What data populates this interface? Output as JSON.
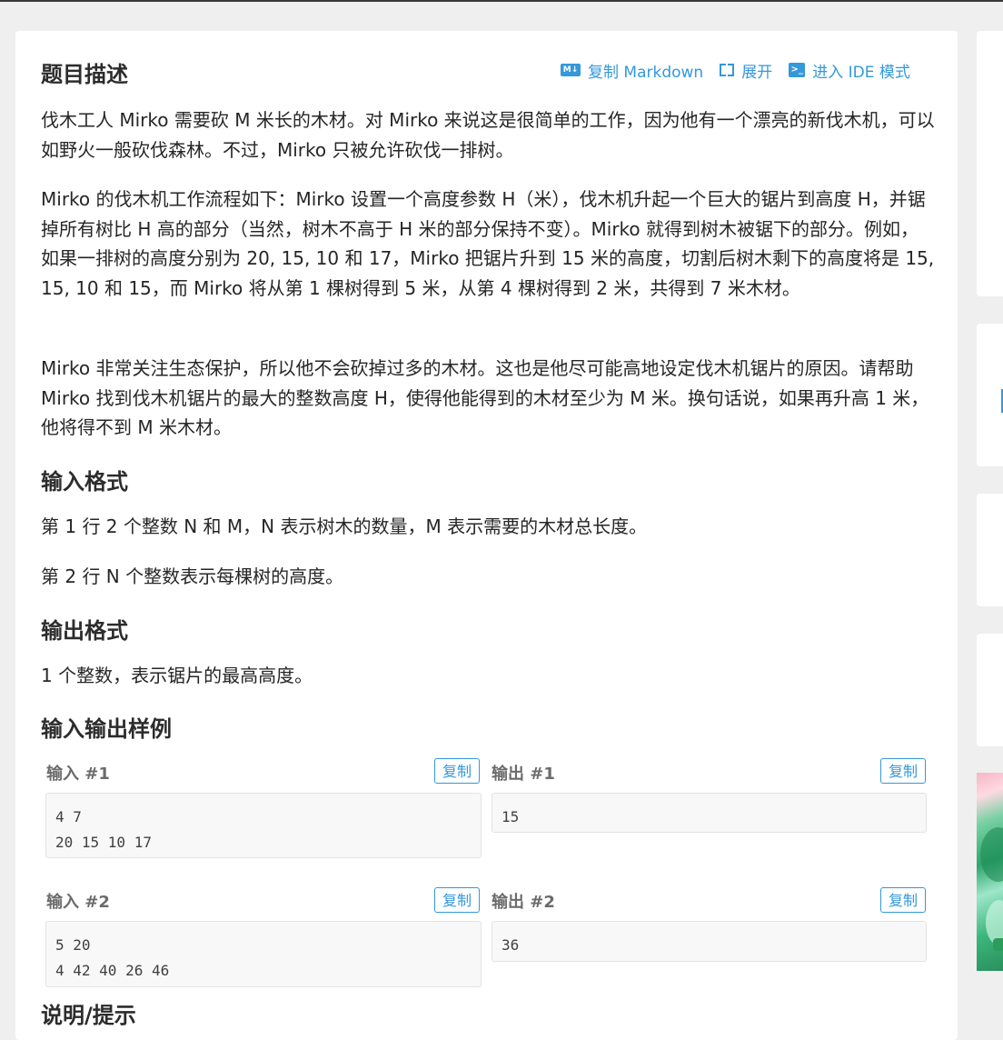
{
  "header": {
    "title": "题目描述",
    "copy_markdown": "复制 Markdown",
    "expand": "展开",
    "enter_ide": "进入 IDE 模式",
    "icon_md": "M↓"
  },
  "description": {
    "p1": "伐木工人 Mirko 需要砍 M 米长的木材。对 Mirko 来说这是很简单的工作，因为他有一个漂亮的新伐木机，可以如野火一般砍伐森林。不过，Mirko 只被允许砍伐一排树。",
    "p2": "Mirko 的伐木机工作流程如下：Mirko 设置一个高度参数 H（米），伐木机升起一个巨大的锯片到高度 H，并锯掉所有树比 H 高的部分（当然，树木不高于 H 米的部分保持不变）。Mirko 就得到树木被锯下的部分。例如，如果一排树的高度分别为 20, 15, 10 和 17，Mirko 把锯片升到 15 米的高度，切割后树木剩下的高度将是 15, 15, 10 和 15，而 Mirko 将从第 1 棵树得到 5 米，从第 4 棵树得到 2 米，共得到 7 米木材。",
    "p3": "Mirko 非常关注生态保护，所以他不会砍掉过多的木材。这也是他尽可能高地设定伐木机锯片的原因。请帮助 Mirko 找到伐木机锯片的最大的整数高度 H，使得他能得到的木材至少为 M 米。换句话说，如果再升高 1 米，他将得不到 M 米木材。"
  },
  "input_format": {
    "heading": "输入格式",
    "line1": "第 1 行 2 个整数 N 和 M，N 表示树木的数量，M 表示需要的木材总长度。",
    "line2": "第 2 行 N 个整数表示每棵树的高度。"
  },
  "output_format": {
    "heading": "输出格式",
    "line1": "1 个整数，表示锯片的最高高度。"
  },
  "samples": {
    "heading": "输入输出样例",
    "copy_label": "复制",
    "items": [
      {
        "in_label": "输入 #1",
        "in_text": "4 7\n20 15 10 17",
        "out_label": "输出 #1",
        "out_text": "15"
      },
      {
        "in_label": "输入 #2",
        "in_text": "5 20\n4 42 40 26 46",
        "out_label": "输出 #2",
        "out_text": "36"
      }
    ]
  },
  "hint": {
    "heading": "说明/提示"
  },
  "colors": {
    "accent": "#3498db",
    "background": "#efefef",
    "card": "#ffffff"
  }
}
